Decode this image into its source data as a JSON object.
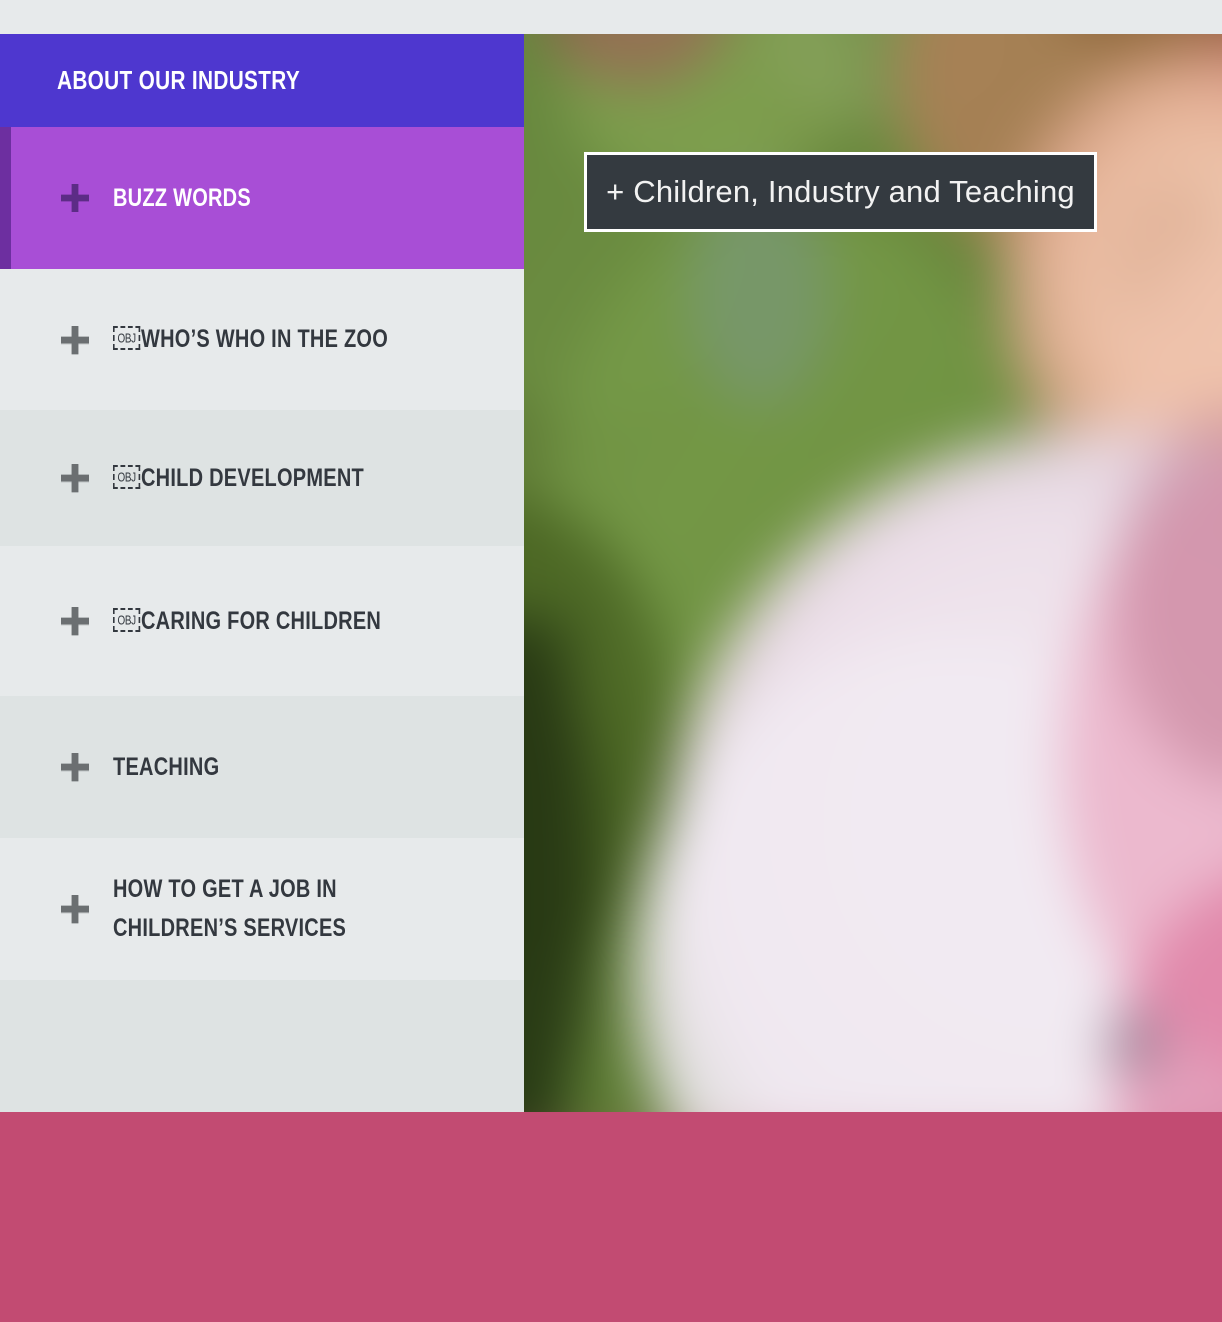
{
  "colors": {
    "page_background": "#e7eaeb",
    "accordion_header_purple": "#4e37cf",
    "active_item_purple": "#a84ed6",
    "active_accent_dark_purple": "#6d2fa0",
    "row_light": "#e7eaeb",
    "row_dark": "#dee3e3",
    "label_text": "#33383f",
    "badge_background": "#343a40",
    "badge_border": "#ffffff",
    "bottom_band_magenta": "#c24b72",
    "plus_icon_gray": "#6b6f71"
  },
  "accordion": {
    "title": "ABOUT OUR INDUSTRY",
    "items": [
      {
        "label": "BUZZ WORDS",
        "prefix_glyph": "",
        "state": "active",
        "icon": "plus-icon"
      },
      {
        "label": "WHO’S WHO IN THE ZOO",
        "prefix_glyph": "OBJ",
        "state": "collapsed",
        "icon": "plus-icon"
      },
      {
        "label": "CHILD DEVELOPMENT",
        "prefix_glyph": "OBJ",
        "state": "collapsed",
        "icon": "plus-icon"
      },
      {
        "label": "CARING FOR CHILDREN",
        "prefix_glyph": "OBJ",
        "state": "collapsed",
        "icon": "plus-icon"
      },
      {
        "label": "TEACHING",
        "prefix_glyph": "",
        "state": "collapsed",
        "icon": "plus-icon"
      },
      {
        "label": "HOW TO GET A JOB IN\nCHILDREN’S SERVICES",
        "prefix_glyph": "",
        "state": "collapsed",
        "icon": "plus-icon"
      }
    ]
  },
  "hero": {
    "badge_label": "+ Children, Industry and Teaching",
    "image_description": "blurred outdoor photo of a child in a pink top against green foliage"
  }
}
